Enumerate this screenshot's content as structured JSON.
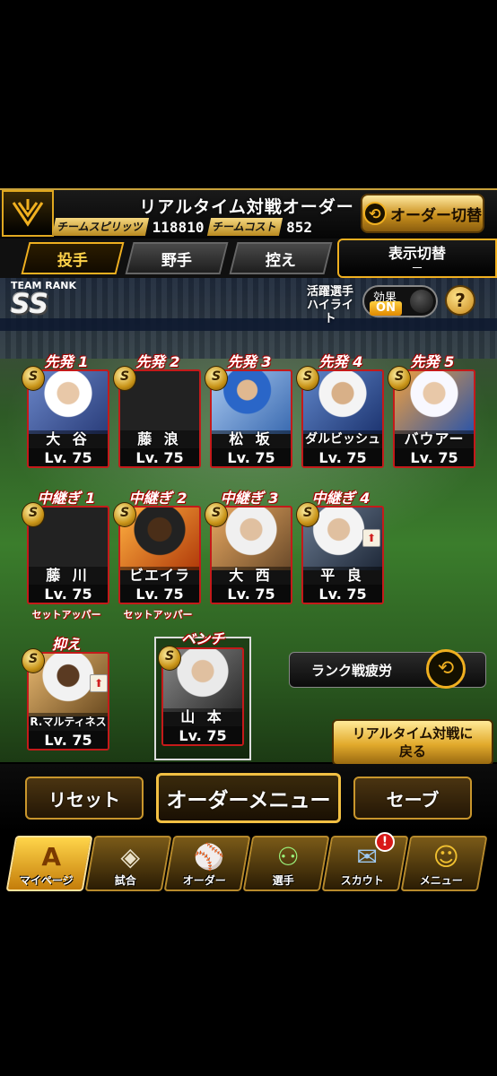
{
  "header": {
    "logo_icon": "giants-logo-icon",
    "title": "リアルタイム対戦オーダー",
    "team_spirit_label": "チームスピリッツ",
    "team_spirit_value": "118810",
    "team_cost_label": "チームコスト",
    "team_cost_value": "852",
    "order_switch_label": "オーダー切替"
  },
  "tabs": [
    {
      "label": "投手",
      "active": true
    },
    {
      "label": "野手",
      "active": false
    },
    {
      "label": "控え",
      "active": false
    }
  ],
  "display_switch": {
    "label": "表示切替",
    "value": "－"
  },
  "team_rank": {
    "label": "TEAM RANK",
    "value": "SS"
  },
  "highlight": {
    "label_line1": "活躍選手",
    "label_line2": "ハイライト",
    "toggle_label": "効果",
    "toggle_value": "ON",
    "help": "?"
  },
  "players": {
    "starters": [
      {
        "slot": "先発 1",
        "name": "大 谷",
        "level": "Lv. 75",
        "badge": "S"
      },
      {
        "slot": "先発 2",
        "name": "藤 浪",
        "level": "Lv. 75",
        "badge": "S"
      },
      {
        "slot": "先発 3",
        "name": "松 坂",
        "level": "Lv. 75",
        "badge": "S"
      },
      {
        "slot": "先発 4",
        "name": "ダルビッシュ",
        "level": "Lv. 75",
        "badge": "S"
      },
      {
        "slot": "先発 5",
        "name": "バウアー",
        "level": "Lv. 75",
        "badge": "S"
      }
    ],
    "relievers": [
      {
        "slot": "中継ぎ 1",
        "name": "藤 川",
        "level": "Lv. 75",
        "badge": "S",
        "role": "セットアッパー"
      },
      {
        "slot": "中継ぎ 2",
        "name": "ビエイラ",
        "level": "Lv. 75",
        "badge": "S",
        "role": "セットアッパー"
      },
      {
        "slot": "中継ぎ 3",
        "name": "大 西",
        "level": "Lv. 75",
        "badge": "S",
        "role": ""
      },
      {
        "slot": "中継ぎ 4",
        "name": "平 良",
        "level": "Lv. 75",
        "badge": "S",
        "role": ""
      }
    ],
    "closer": {
      "slot": "抑え",
      "name": "R.マルティネス",
      "level": "Lv. 75",
      "badge": "S"
    },
    "bench": {
      "slot": "ベンチ",
      "name": "山 本",
      "level": "Lv. 75",
      "badge": "S"
    }
  },
  "right_panel": {
    "rank_fatigue_label": "ランク戦疲労",
    "back_line1": "リアルタイム対戦に",
    "back_line2": "戻る"
  },
  "actions": {
    "reset": "リセット",
    "order_menu": "オーダーメニュー",
    "save": "セーブ"
  },
  "nav": [
    {
      "label": "マイページ",
      "icon": "mypage-icon",
      "active": true
    },
    {
      "label": "試合",
      "icon": "stadium-icon",
      "active": false
    },
    {
      "label": "オーダー",
      "icon": "field-order-icon",
      "active": false
    },
    {
      "label": "選手",
      "icon": "player-icon",
      "active": false
    },
    {
      "label": "スカウト",
      "icon": "scout-icon",
      "active": false,
      "badge": "!"
    },
    {
      "label": "メニュー",
      "icon": "menu-character-icon",
      "active": false
    }
  ]
}
